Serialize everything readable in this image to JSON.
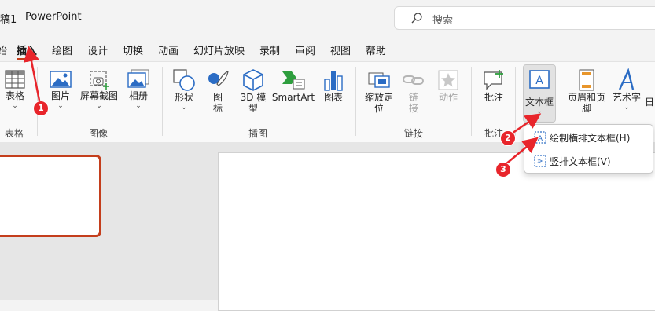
{
  "titlebar": {
    "doc_title": "稿1",
    "app_name": "PowerPoint",
    "search_placeholder": "搜索"
  },
  "tabs": [
    "始",
    "插入",
    "绘图",
    "设计",
    "切换",
    "动画",
    "幻灯片放映",
    "录制",
    "审阅",
    "视图",
    "帮助"
  ],
  "ribbon": {
    "groups": {
      "tables": "表格",
      "images": "图像",
      "illustrations": "插图",
      "links": "链接",
      "comments": "批注"
    },
    "commands": {
      "table": "表格",
      "pictures": "图片",
      "screenshot": "屏幕截图",
      "album": "相册",
      "shapes": "形状",
      "icons_1": "图",
      "icons_2": "标",
      "model3d_1": "3D 模",
      "model3d_2": "型",
      "smartart": "SmartArt",
      "chart": "图表",
      "zoom_1": "缩放定",
      "zoom_2": "位",
      "link_1": "链",
      "link_2": "接",
      "action": "动作",
      "comment": "批注",
      "textbox": "文本框",
      "header_footer": "页眉和页脚",
      "wordart": "艺术字",
      "date_cut": "日"
    }
  },
  "textbox_menu": {
    "horizontal": "绘制横排文本框(H)",
    "vertical": "竖排文本框(V)"
  },
  "annotations": {
    "step1": "1",
    "step2": "2",
    "step3": "3"
  },
  "colors": {
    "accent": "#c43e1c",
    "badge": "#e8252b",
    "icon_blue": "#2b6cc4"
  }
}
